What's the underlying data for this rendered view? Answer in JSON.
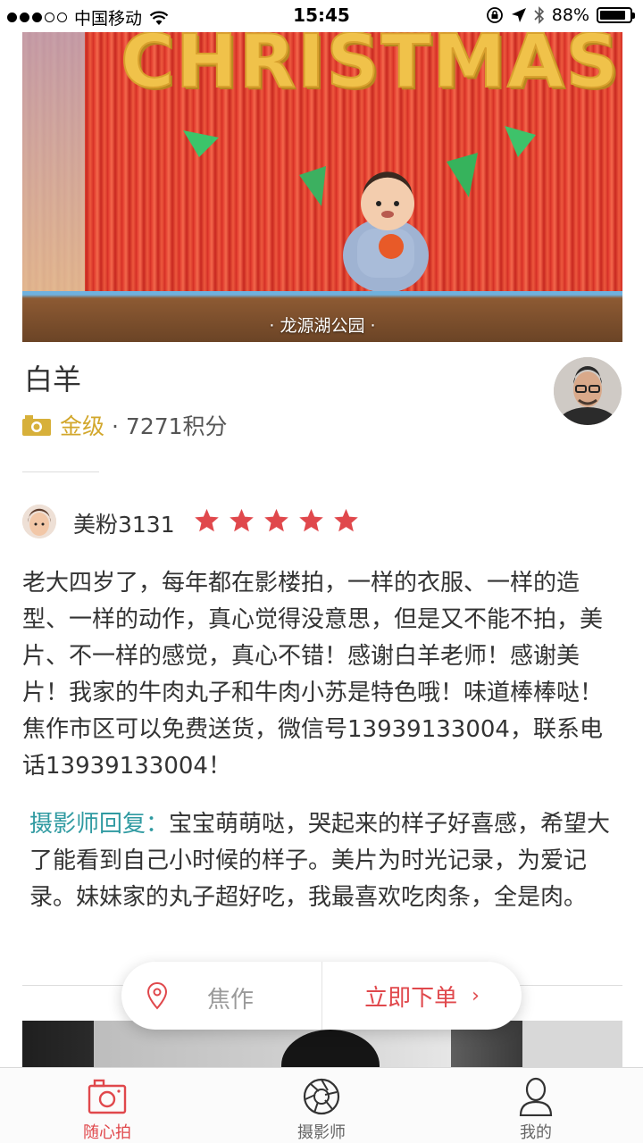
{
  "status_bar": {
    "carrier": "中国移动",
    "time": "15:45",
    "battery": "88%",
    "battery_level": 0.88
  },
  "hero": {
    "banner_text": "CHRISTMAS",
    "caption": "· 龙源湖公园 ·"
  },
  "photographer": {
    "name": "白羊",
    "level": "金级",
    "points": "· 7271积分"
  },
  "review": {
    "reviewer": "美粉3131",
    "rating": 5,
    "text": "老大四岁了，每年都在影楼拍，一样的衣服、一样的造型、一样的动作，真心觉得没意思，但是又不能不拍，美片、不一样的感觉，真心不错！感谢白羊老师！感谢美片！我家的牛肉丸子和牛肉小苏是特色哦！味道棒棒哒！焦作市区可以免费送货，微信号13939133004，联系电话13939133004！",
    "reply_label": "摄影师回复：",
    "reply_text": "宝宝萌萌哒，哭起来的样子好喜感，希望大了能看到自己小时候的样子。美片为时光记录，为爱记录。妹妹家的丸子超好吃，我最喜欢吃肉条，全是肉。"
  },
  "float_bar": {
    "city": "焦作",
    "order_label": "立即下单",
    "chevron": "›"
  },
  "tabs": [
    {
      "label": "随心拍",
      "icon": "camera-icon",
      "active": true
    },
    {
      "label": "摄影师",
      "icon": "aperture-icon",
      "active": false
    },
    {
      "label": "我的",
      "icon": "user-icon",
      "active": false
    }
  ],
  "colors": {
    "accent": "#e0484c",
    "gold": "#d2a72c",
    "reply": "#2f9aa1"
  }
}
